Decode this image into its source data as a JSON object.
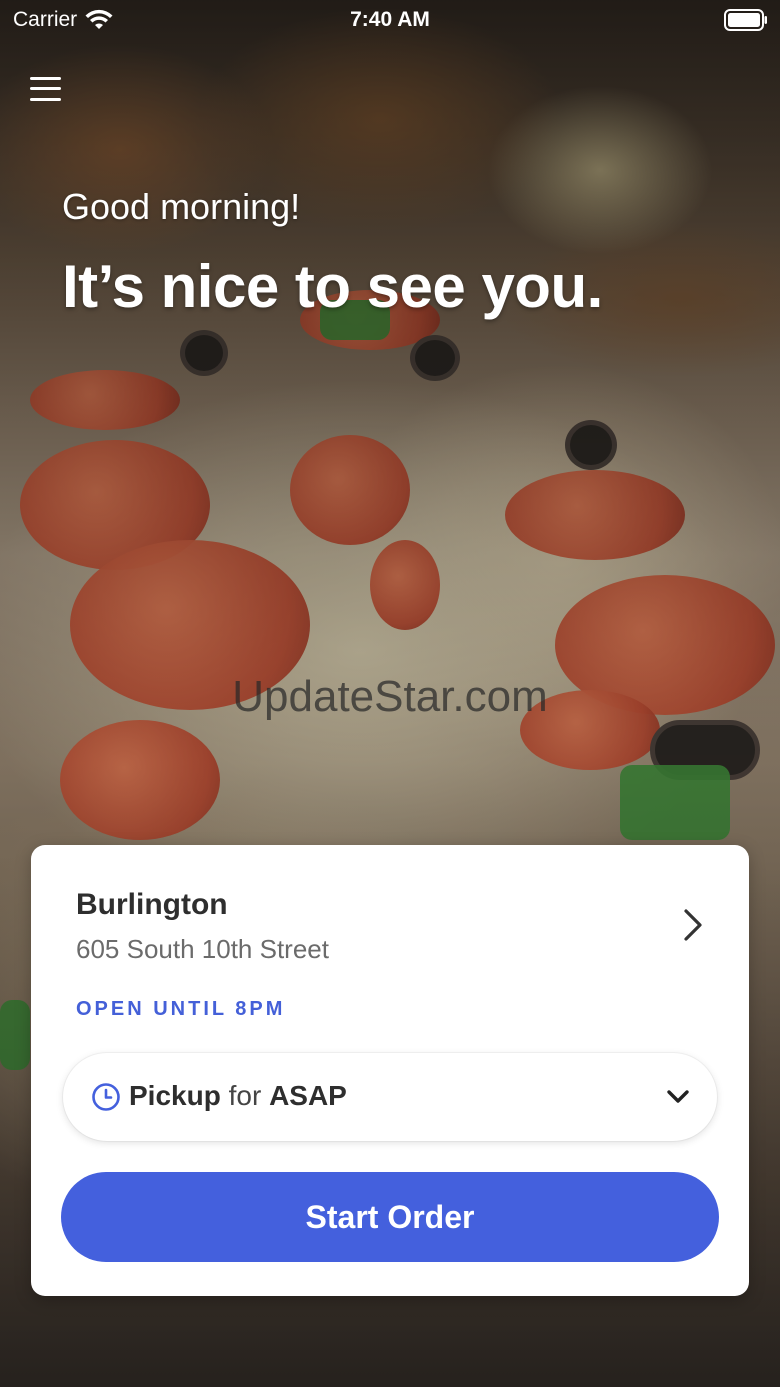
{
  "status_bar": {
    "carrier": "Carrier",
    "time": "7:40 AM"
  },
  "header": {
    "greeting": "Good morning!",
    "headline": "It’s nice to see you."
  },
  "watermark": "UpdateStar.com",
  "location_card": {
    "name": "Burlington",
    "address": "605 South 10th Street",
    "hours": "OPEN UNTIL 8PM",
    "order_type": "Pickup",
    "connector": "for",
    "order_time": "ASAP",
    "start_button_label": "Start Order"
  },
  "colors": {
    "accent": "#4460dd",
    "hours_text": "#4460d8",
    "card_bg": "#ffffff"
  },
  "icons": {
    "menu": "hamburger-menu-icon",
    "location_chevron": "chevron-right-icon",
    "time": "clock-icon",
    "dropdown": "chevron-down-icon",
    "wifi": "wifi-icon",
    "battery": "battery-icon"
  }
}
